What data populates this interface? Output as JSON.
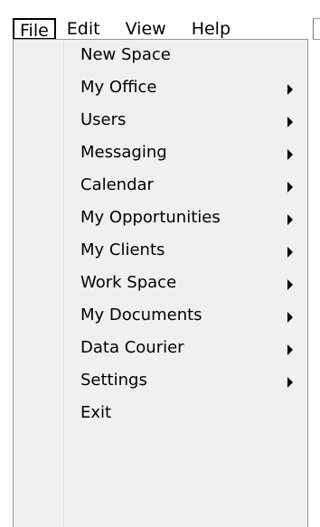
{
  "menubar": {
    "items": [
      {
        "label": "File"
      },
      {
        "label": "Edit"
      },
      {
        "label": "View"
      },
      {
        "label": "Help"
      }
    ]
  },
  "file_menu": {
    "items": [
      {
        "label": "New Space",
        "has_submenu": false
      },
      {
        "label": "My Office",
        "has_submenu": true,
        "arrow_icon": "submenu-arrow-icon"
      },
      {
        "label": "Users",
        "has_submenu": true,
        "arrow_icon": "submenu-arrow-icon"
      },
      {
        "label": "Messaging",
        "has_submenu": true,
        "arrow_icon": "submenu-arrow-icon"
      },
      {
        "label": "Calendar",
        "has_submenu": true,
        "arrow_icon": "submenu-arrow-icon"
      },
      {
        "label": "My Opportunities",
        "has_submenu": true,
        "arrow_icon": "submenu-arrow-icon"
      },
      {
        "label": "My Clients",
        "has_submenu": true,
        "arrow_icon": "submenu-arrow-icon"
      },
      {
        "label": "Work Space",
        "has_submenu": true,
        "arrow_icon": "submenu-arrow-icon"
      },
      {
        "label": "My Documents",
        "has_submenu": true,
        "arrow_icon": "submenu-arrow-icon"
      },
      {
        "label": "Data Courier",
        "has_submenu": true,
        "arrow_icon": "submenu-arrow-icon"
      },
      {
        "label": "Settings",
        "has_submenu": true,
        "arrow_icon": "submenu-arrow-icon"
      },
      {
        "label": "Exit",
        "has_submenu": false
      }
    ]
  },
  "colors": {
    "menu_background": "#f0f0f0",
    "menu_border": "#979797",
    "text": "#000000"
  }
}
